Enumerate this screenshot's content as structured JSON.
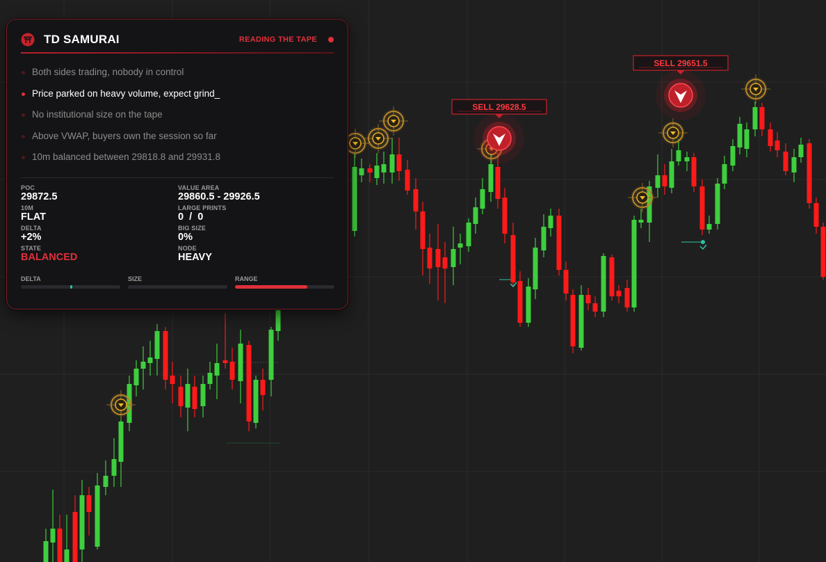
{
  "panel": {
    "title": "TD SAMURAI",
    "status": "READING THE TAPE",
    "logo_icon": "samurai-torii-icon",
    "accent": "#e0303a",
    "messages": [
      {
        "text": "Both sides trading, nobody in control",
        "active": false
      },
      {
        "text": "Price parked on heavy volume, expect grind_",
        "active": true
      },
      {
        "text": "No institutional size on the tape",
        "active": false
      },
      {
        "text": "Above VWAP, buyers own the session so far",
        "active": false
      },
      {
        "text": "10m balanced between 29818.8 and 29931.8",
        "active": false
      }
    ],
    "stats": {
      "poc": {
        "label": "POC",
        "value": "29872.5"
      },
      "value_area": {
        "label": "VALUE AREA",
        "value": "29860.5 - 29926.5"
      },
      "tenm": {
        "label": "10M",
        "value": "FLAT"
      },
      "large_prints": {
        "label": "LARGE PRINTS",
        "value": "0  /  0"
      },
      "delta": {
        "label": "DELTA",
        "value": "+2%"
      },
      "big_size": {
        "label": "BIG SIZE",
        "value": "0%"
      },
      "state": {
        "label": "STATE",
        "value": "BALANCED"
      },
      "node": {
        "label": "NODE",
        "value": "HEAVY"
      }
    },
    "bars": {
      "delta": {
        "label": "DELTA",
        "level": 0.51,
        "color": "#2dbfa0"
      },
      "size": {
        "label": "SIZE",
        "level": 0.0,
        "color": "#3a3a3e"
      },
      "range": {
        "label": "RANGE",
        "level": 0.73,
        "color": "#e0303a"
      }
    }
  },
  "chart_data": {
    "type": "candlestick",
    "up_color": "#3ecf3e",
    "down_color": "#ff1a1a",
    "background": "#1f1f1f",
    "grid": true,
    "signals": [
      {
        "label": "SELL  29628.5",
        "type": "sell"
      },
      {
        "label": "SELL  29651.5",
        "type": "sell"
      }
    ],
    "marker_icon": "chevron-down-circle-icon",
    "sell_icon": "sell-arrow-icon"
  }
}
